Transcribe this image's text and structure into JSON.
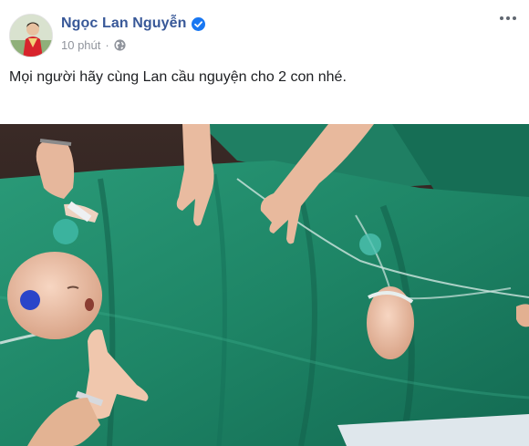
{
  "post": {
    "author": {
      "name": "Ngọc Lan Nguyễn",
      "verified": true
    },
    "timestamp": "10 phút",
    "separator": "·",
    "audience_icon": "globe-icon",
    "more_icon": "ellipsis-icon",
    "caption": "Mọi người hãy cùng Lan cầu nguyện cho 2 con nhé.",
    "colors": {
      "author_link": "#385898",
      "verified_badge": "#1877f2",
      "meta_text": "#90949c",
      "caption_text": "#1c1e21",
      "surgical_drape": "#1f8a6b"
    }
  }
}
